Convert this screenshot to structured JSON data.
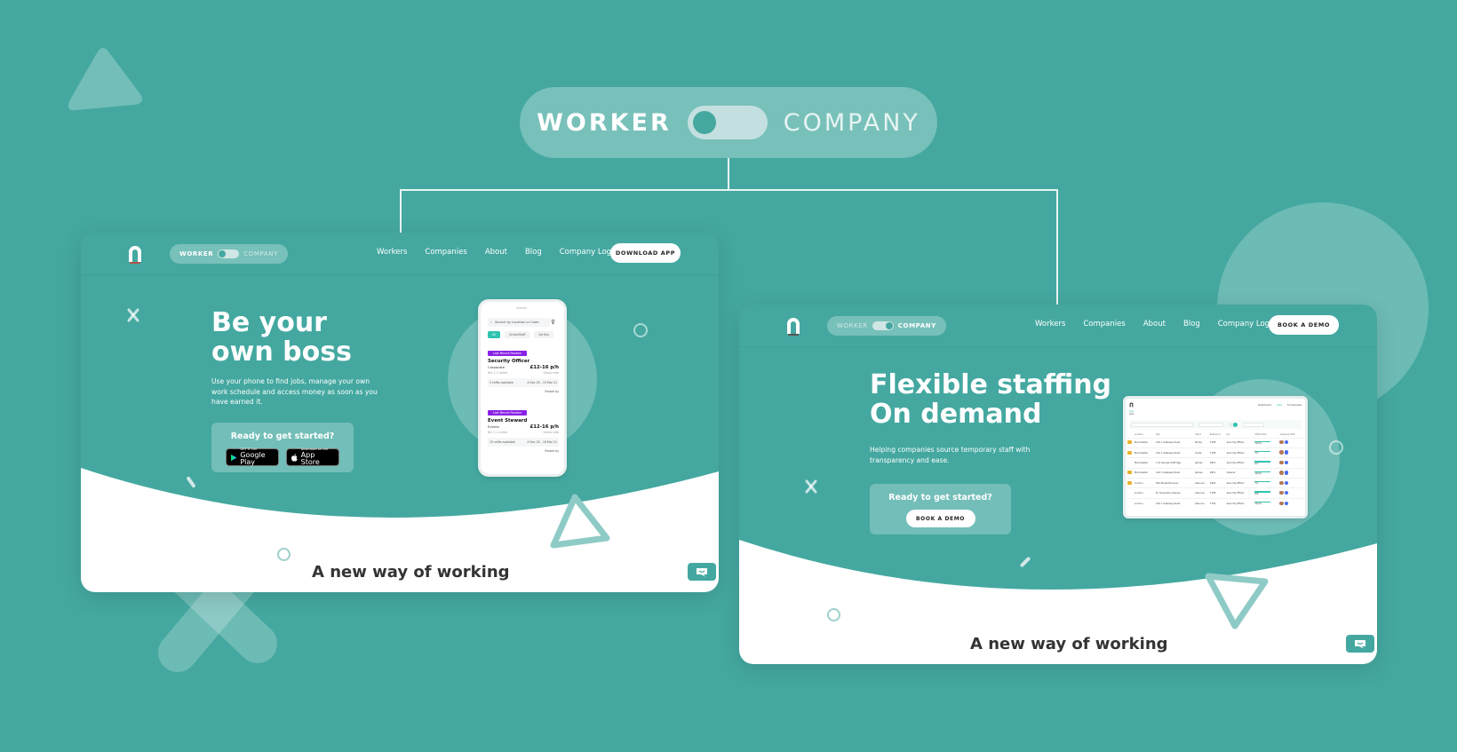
{
  "main_toggle": {
    "left_label": "WORKER",
    "right_label": "COMPANY",
    "selected": "WORKER"
  },
  "colors": {
    "brand_teal": "#44a8a0",
    "accent_green": "#2ec4b0",
    "badge_purple": "#8a22e6",
    "heading_dark": "#333333"
  },
  "worker_site": {
    "nav": {
      "toggle_left": "WORKER",
      "toggle_right": "COMPANY",
      "links": [
        "Workers",
        "Companies",
        "About",
        "Blog",
        "Company Login"
      ],
      "cta": "DOWNLOAD APP"
    },
    "hero": {
      "title_line1": "Be your",
      "title_line2": "own boss",
      "subtitle": "Use your phone to find jobs, manage your own work schedule and access money as soon as you have earned it.",
      "cta_title": "Ready to get started?",
      "google_play_small": "GET IT ON",
      "google_play_big": "Google Play",
      "app_store_small": "Download on the",
      "app_store_big": "App Store"
    },
    "phone": {
      "search_placeholder": "Search by Location or Code",
      "chips": [
        "All",
        "SmartStaff",
        "Ad Hoc"
      ],
      "jobs": [
        {
          "badge": "Last Minute Position",
          "title": "Security Officer",
          "category": "Corporate",
          "location": "W1 1.1 miles",
          "price": "£12-16 p/h",
          "price_note": "Gross rate",
          "shifts": "5 shifts available",
          "dates": "4 Dec 20 - 15 Mar 21",
          "posted": "Posted by"
        },
        {
          "badge": "Last Minute Position",
          "title": "Event Steward",
          "category": "Events",
          "location": "W1 1.1 miles",
          "price": "£12-16 p/h",
          "price_note": "Gross rate",
          "shifts": "15 shifts available",
          "dates": "4 Dec 20 - 18 Mar 21",
          "posted": "Posted by"
        }
      ]
    },
    "section_title": "A new way of working"
  },
  "company_site": {
    "nav": {
      "toggle_left": "WORKER",
      "toggle_right": "COMPANY",
      "links": [
        "Workers",
        "Companies",
        "About",
        "Blog",
        "Company Login"
      ],
      "cta": "BOOK A DEMO"
    },
    "hero": {
      "title_line1": "Flexible staffing",
      "title_line2": "On demand",
      "subtitle": "Helping companies source temporary staff with transparency and ease.",
      "cta_title": "Ready to get started?",
      "cta_button": "BOOK A DEMO"
    },
    "dashboard": {
      "tabs": [
        "Dashboard",
        "Jobs",
        "Timesheets"
      ],
      "active_tab": "Jobs",
      "breadcrumb": [
        "Jobs",
        "Jobs"
      ],
      "filters": [
        "Jobs & Shifts",
        "Search by job name",
        "Date / Time",
        "Any time",
        "Status"
      ],
      "columns": [
        "Location",
        "Site",
        "Client",
        "Reference",
        "Job",
        "Shifts filled",
        "Assigned staff"
      ],
      "rows": [
        {
          "location": "Manchester",
          "site": "Unit 1 Gateway Road",
          "client": "Phoby",
          "ref": "7198",
          "job": "Security Officer",
          "filled": "10/14"
        },
        {
          "location": "Manchester",
          "site": "Unit 1 Gateway Road",
          "client": "Costa",
          "ref": "7198",
          "job": "Security Officer",
          "filled": "7/7"
        },
        {
          "location": "Manchester",
          "site": "1 St George St Bridge",
          "client": "Jaimes",
          "ref": "2812",
          "job": "Security Officer",
          "filled": "6/7"
        },
        {
          "location": "Manchester",
          "site": "Unit 1 Gateway Road",
          "client": "Jaimes",
          "ref": "2812",
          "job": "Cleaner",
          "filled": "10/14"
        },
        {
          "location": "London",
          "site": "Hall Street Brauerei",
          "client": "Glencoe",
          "ref": "2920",
          "job": "Security Officer",
          "filled": "7/7"
        },
        {
          "location": "London",
          "site": "St. St James's Square",
          "client": "Glencoe",
          "ref": "7198",
          "job": "Security Officer",
          "filled": "8/8"
        },
        {
          "location": "London",
          "site": "Unit 1 Gateway Road",
          "client": "Glencoe",
          "ref": "7792",
          "job": "Security Officer",
          "filled": "10/14"
        }
      ]
    },
    "section_title": "A new way of working"
  },
  "icons": {
    "logo": "arch-logo-icon",
    "chat": "chat-bubble-icon",
    "search": "search-icon",
    "filter": "filter-icon",
    "google_play": "play-triangle-icon",
    "apple": "apple-icon"
  }
}
